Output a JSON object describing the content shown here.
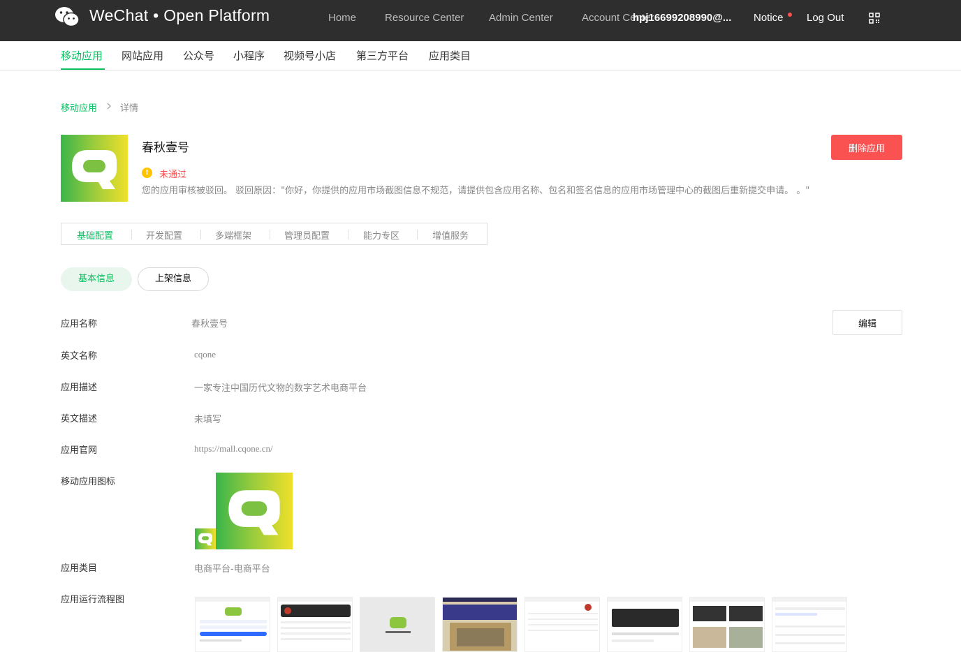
{
  "header": {
    "brand": "WeChat • Open Platform",
    "nav": [
      "Home",
      "Resource Center",
      "Admin Center",
      "Account Center"
    ],
    "user_email": "hpj16699208990@...",
    "notice_label": "Notice",
    "logout_label": "Log Out"
  },
  "subnav": {
    "items": [
      "移动应用",
      "网站应用",
      "公众号",
      "小程序",
      "视频号小店",
      "第三方平台",
      "应用类目"
    ],
    "active_index": 0
  },
  "breadcrumb": {
    "parent": "移动应用",
    "separator": ">",
    "current": "详情"
  },
  "app": {
    "name": "春秋壹号",
    "status_icon": "!",
    "status": "未通过",
    "reject_message": "您的应用审核被驳回。 驳回原因：\"你好，你提供的应用市场截图信息不规范，请提供包含应用名称、包名和签名信息的应用市场管理中心的截图后重新提交申请。 。\"",
    "delete_label": "删除应用"
  },
  "config_tabs": {
    "items": [
      "基础配置",
      "开发配置",
      "多端框架",
      "管理员配置",
      "能力专区",
      "增值服务"
    ],
    "active_index": 0
  },
  "info_tabs": {
    "basic": "基本信息",
    "listing": "上架信息"
  },
  "edit_label": "编辑",
  "fields": [
    {
      "label": "应用名称",
      "value": "春秋壹号"
    },
    {
      "label": "英文名称",
      "value": "cqone"
    },
    {
      "label": "应用描述",
      "value": "一家专注中国历代文物的数字艺术电商平台"
    },
    {
      "label": "英文描述",
      "value": "未填写"
    },
    {
      "label": "应用官网",
      "value": "https://mall.cqone.cn/"
    },
    {
      "label": "移动应用图标",
      "value": ""
    },
    {
      "label": "应用类目",
      "value": "电商平台-电商平台"
    },
    {
      "label": "应用运行流程图",
      "value": ""
    }
  ],
  "colors": {
    "brand_green": "#07c160",
    "danger": "#fa5151",
    "warning": "#ffc300",
    "topbar": "#2e2e2e"
  },
  "icons": {
    "logo": "wechat-logo-icon",
    "qr": "qr-code-icon",
    "status": "warning-icon"
  }
}
